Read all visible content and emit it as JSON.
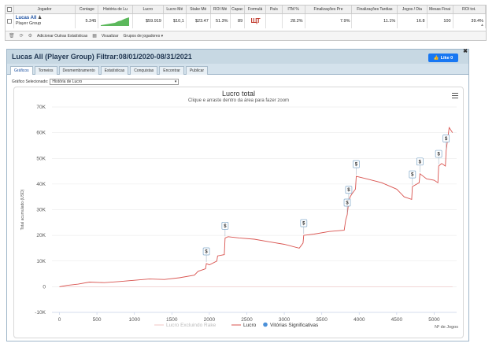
{
  "grid": {
    "columns": [
      "",
      "Jogador",
      "Contage",
      "História de Lu",
      "Lucro",
      "Lucro Mé",
      "Stake Mé",
      "ROI Mé",
      "Capac",
      "Formulá",
      "País",
      "ITM %",
      "Finalizações Pre",
      "Finalizações Tardias",
      "Jogos / Dia",
      "Mesas Finai",
      "ROI tot."
    ],
    "row": {
      "player_name": "Lucas All",
      "player_group": "Player Group",
      "count": "5.245",
      "lucro": "$59.919",
      "lucro_medio": "$10,1",
      "stake_medio": "$23.47",
      "roi_medio": "51.3%",
      "capac": "89",
      "formula": "ЩТ",
      "pais": "",
      "itm": "28.2%",
      "fin_pre": "7.9%",
      "fin_tardias": "11.1%",
      "jogos_dia": "16.8",
      "mesas_finais": "100",
      "roi_tot": "39.4%"
    },
    "footer": {
      "add_stats": "Adicionar Outras Estatísticas",
      "view": "Visualizar",
      "groups": "Grupos de jogadores"
    }
  },
  "panel": {
    "title": "Lucas All (Player Group) Filtrar:08/01/2020-08/31/2021",
    "like_label": "Like 0",
    "tabs": [
      "Gráficos",
      "Torneios",
      "Desmembramento",
      "Estatísticas",
      "Conquistas",
      "Encontrar",
      "Publicar"
    ],
    "active_tab": 0,
    "select_label": "Gráfico Selecionado:",
    "select_value": "História de Lucro"
  },
  "colors": {
    "profit_line": "#d9534f",
    "no_rake_line": "#f2c4c3",
    "significant_marker": "#4a90d9",
    "accent": "#1a4fa0"
  },
  "chart_data": {
    "type": "line",
    "title": "Lucro total",
    "subtitle": "Clique e arraste dentro da área para fazer zoom",
    "ylabel": "Total acumulado (USD)",
    "xlabel": "Nº de Jogos",
    "xlim": [
      -100,
      5300
    ],
    "ylim": [
      -10000,
      70000
    ],
    "xticks": [
      0,
      500,
      1000,
      1500,
      2000,
      2500,
      3000,
      3500,
      4000,
      4500,
      5000
    ],
    "yticks": [
      -10000,
      0,
      10000,
      20000,
      30000,
      40000,
      50000,
      60000,
      70000
    ],
    "ytick_labels": [
      "-10K",
      "0",
      "10K",
      "20K",
      "30K",
      "40K",
      "50K",
      "60K",
      "70K"
    ],
    "series": [
      {
        "name": "Lucro Excluindo Rake",
        "x": [
          0,
          5245
        ],
        "y": [
          0,
          0
        ]
      },
      {
        "name": "Lucro",
        "x": [
          0,
          100,
          250,
          400,
          600,
          800,
          1000,
          1200,
          1400,
          1600,
          1800,
          1850,
          1950,
          1960,
          2000,
          2100,
          2110,
          2200,
          2210,
          2250,
          2400,
          2600,
          2800,
          3000,
          3200,
          3250,
          3260,
          3400,
          3600,
          3800,
          3820,
          3840,
          3860,
          3880,
          3900,
          3950,
          3960,
          4100,
          4300,
          4500,
          4600,
          4700,
          4710,
          4800,
          4810,
          4900,
          5000,
          5050,
          5060,
          5100,
          5150,
          5160,
          5200,
          5245
        ],
        "y": [
          0,
          500,
          1000,
          1800,
          1600,
          2000,
          2500,
          3000,
          2800,
          3500,
          4500,
          6000,
          7000,
          9000,
          8500,
          10000,
          12000,
          12500,
          19000,
          19500,
          19000,
          18500,
          17500,
          16500,
          15000,
          17000,
          20000,
          20500,
          21500,
          22000,
          26000,
          28000,
          33000,
          35000,
          36000,
          38000,
          43000,
          42000,
          40500,
          38000,
          35000,
          34000,
          39000,
          40500,
          44000,
          42000,
          41500,
          40500,
          47000,
          48000,
          47000,
          53000,
          62000,
          60000
        ]
      }
    ],
    "markers": {
      "name": "Vitórias Significativas",
      "label": "$",
      "points": [
        {
          "x": 1960,
          "y": 9000
        },
        {
          "x": 2210,
          "y": 19000
        },
        {
          "x": 3260,
          "y": 20000
        },
        {
          "x": 3840,
          "y": 28000
        },
        {
          "x": 3860,
          "y": 33000
        },
        {
          "x": 3960,
          "y": 43000
        },
        {
          "x": 4710,
          "y": 39000
        },
        {
          "x": 4810,
          "y": 44000
        },
        {
          "x": 5060,
          "y": 47000
        },
        {
          "x": 5160,
          "y": 53000
        }
      ]
    },
    "legend": [
      "Lucro Excluindo Rake",
      "Lucro",
      "Vitórias Significativas"
    ],
    "legend_position": "bottom-center",
    "grid": true
  }
}
